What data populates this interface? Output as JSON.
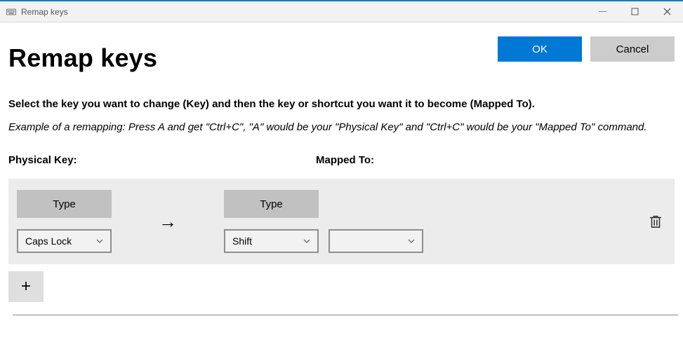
{
  "titlebar": {
    "title": "Remap keys"
  },
  "header": {
    "page_title": "Remap keys",
    "ok_label": "OK",
    "cancel_label": "Cancel"
  },
  "instructions": "Select the key you want to change (Key) and then the key or shortcut you want it to become (Mapped To).",
  "example": "Example of a remapping: Press A and get \"Ctrl+C\", \"A\" would be your \"Physical Key\" and \"Ctrl+C\" would be your \"Mapped To\" command.",
  "columns": {
    "physical": "Physical Key:",
    "mapped": "Mapped To:"
  },
  "row": {
    "type_label": "Type",
    "physical_key": "Caps Lock",
    "mapped_key_1": "Shift",
    "mapped_key_2": "",
    "arrow": "→"
  },
  "add_label": "+",
  "icons": {
    "keyboard": "keyboard-icon",
    "minimize": "minimize-icon",
    "maximize": "maximize-icon",
    "close": "close-icon",
    "chevron": "chevron-down-icon",
    "trash": "trash-icon",
    "arrow": "arrow-right-icon",
    "plus": "plus-icon"
  }
}
